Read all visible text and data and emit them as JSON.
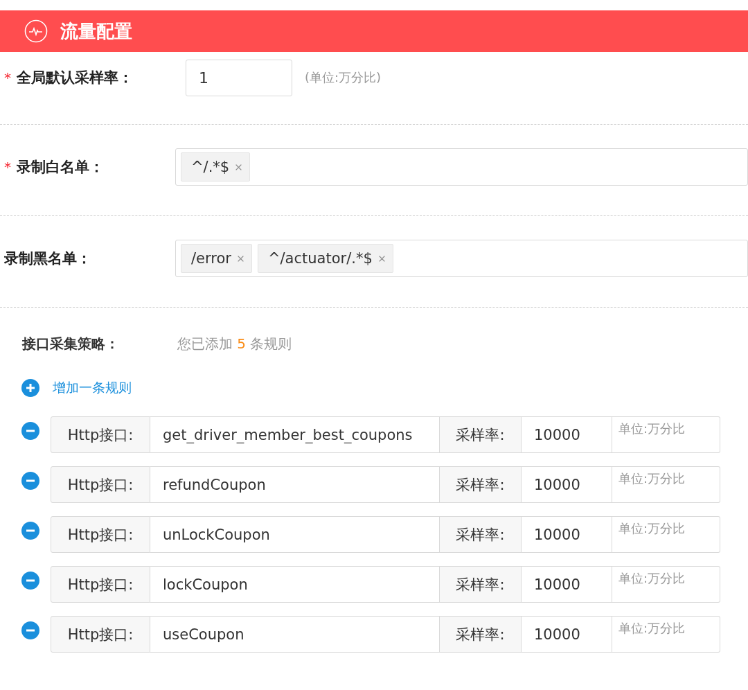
{
  "header": {
    "title": "流量配置"
  },
  "fields": [
    {
      "kind": "input",
      "label": "全局默认采样率：",
      "required_mark": "*",
      "value": "1",
      "hint": "(单位:万分比)"
    },
    {
      "kind": "tags",
      "label": "录制白名单：",
      "required_mark": "*",
      "tags": [
        "^/.*$"
      ]
    },
    {
      "kind": "tags",
      "label": "录制黑名单：",
      "tags": [
        "/error",
        "^/actuator/.*$"
      ]
    }
  ],
  "strategy": {
    "label": "接口采集策略：",
    "count_prefix": "您已添加",
    "count": "5",
    "count_suffix": "条规则",
    "add_label": "增加一条规则"
  },
  "rules": [
    {
      "type_label": "Http接口:",
      "name": "get_driver_member_best_coupons",
      "rate_label": "采样率:",
      "rate": "10000",
      "unit_placeholder": "单位:万分比"
    },
    {
      "type_label": "Http接口:",
      "name": "refundCoupon",
      "rate_label": "采样率:",
      "rate": "10000",
      "unit_placeholder": "单位:万分比"
    },
    {
      "type_label": "Http接口:",
      "name": "unLockCoupon",
      "rate_label": "采样率:",
      "rate": "10000",
      "unit_placeholder": "单位:万分比"
    },
    {
      "type_label": "Http接口:",
      "name": "lockCoupon",
      "rate_label": "采样率:",
      "rate": "10000",
      "unit_placeholder": "单位:万分比"
    },
    {
      "type_label": "Http接口:",
      "name": "useCoupon",
      "rate_label": "采样率:",
      "rate": "10000",
      "unit_placeholder": "单位:万分比"
    }
  ]
}
